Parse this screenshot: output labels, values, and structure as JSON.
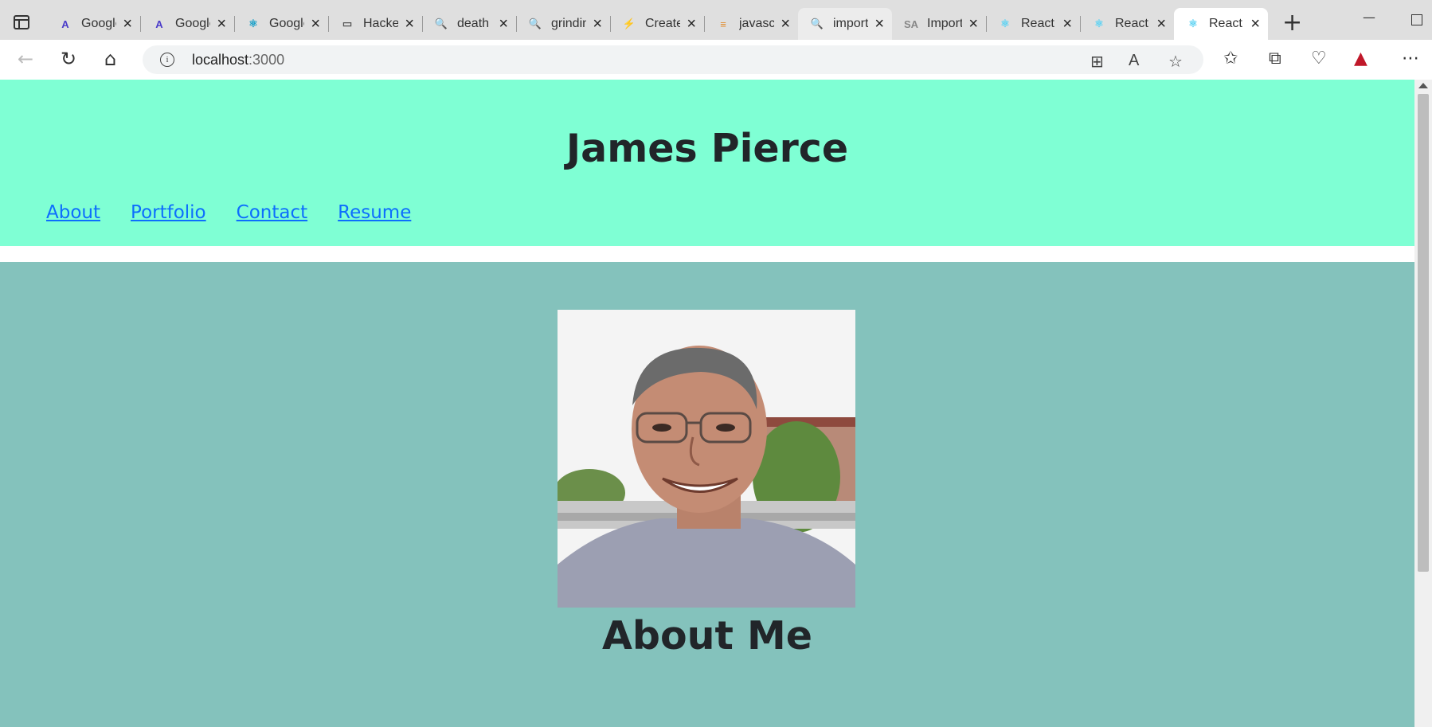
{
  "browser": {
    "tabs": [
      {
        "title": "Google",
        "favicon": "A",
        "favicon_color": "#4b3cc9",
        "state": "normal"
      },
      {
        "title": "Google",
        "favicon": "A",
        "favicon_color": "#4b3cc9",
        "state": "normal"
      },
      {
        "title": "Google",
        "favicon": "⚛",
        "favicon_color": "#1aa0c8",
        "state": "normal"
      },
      {
        "title": "Hacker",
        "favicon": "▭",
        "favicon_color": "#555555",
        "state": "normal"
      },
      {
        "title": "death",
        "favicon": "🔍",
        "favicon_color": "#4a7fe0",
        "state": "normal"
      },
      {
        "title": "grinding",
        "favicon": "🔍",
        "favicon_color": "#4a7fe0",
        "state": "normal"
      },
      {
        "title": "Create",
        "favicon": "⚡",
        "favicon_color": "#3bb5c8",
        "state": "normal"
      },
      {
        "title": "javascript",
        "favicon": "≡",
        "favicon_color": "#e08a2a",
        "state": "normal"
      },
      {
        "title": "import",
        "favicon": "🔍",
        "favicon_color": "#1b5fd6",
        "state": "highlight"
      },
      {
        "title": "Import",
        "favicon": "SA",
        "favicon_color": "#888888",
        "state": "normal"
      },
      {
        "title": "React",
        "favicon": "⚛",
        "favicon_color": "#5fd3f3",
        "state": "normal"
      },
      {
        "title": "React",
        "favicon": "⚛",
        "favicon_color": "#5fd3f3",
        "state": "normal"
      },
      {
        "title": "React",
        "favicon": "⚛",
        "favicon_color": "#5fd3f3",
        "state": "active"
      }
    ],
    "new_tab_label": "+",
    "address": {
      "host": "localhost",
      "port": ":3000"
    }
  },
  "page": {
    "title": "James Pierce",
    "nav": [
      "About",
      "Portfolio",
      "Contact",
      "Resume"
    ],
    "about_heading": "About Me",
    "colors": {
      "header_bg": "#7fffd4",
      "about_bg": "#84c2bc",
      "link": "#0d6efd",
      "heading": "#212529"
    }
  }
}
